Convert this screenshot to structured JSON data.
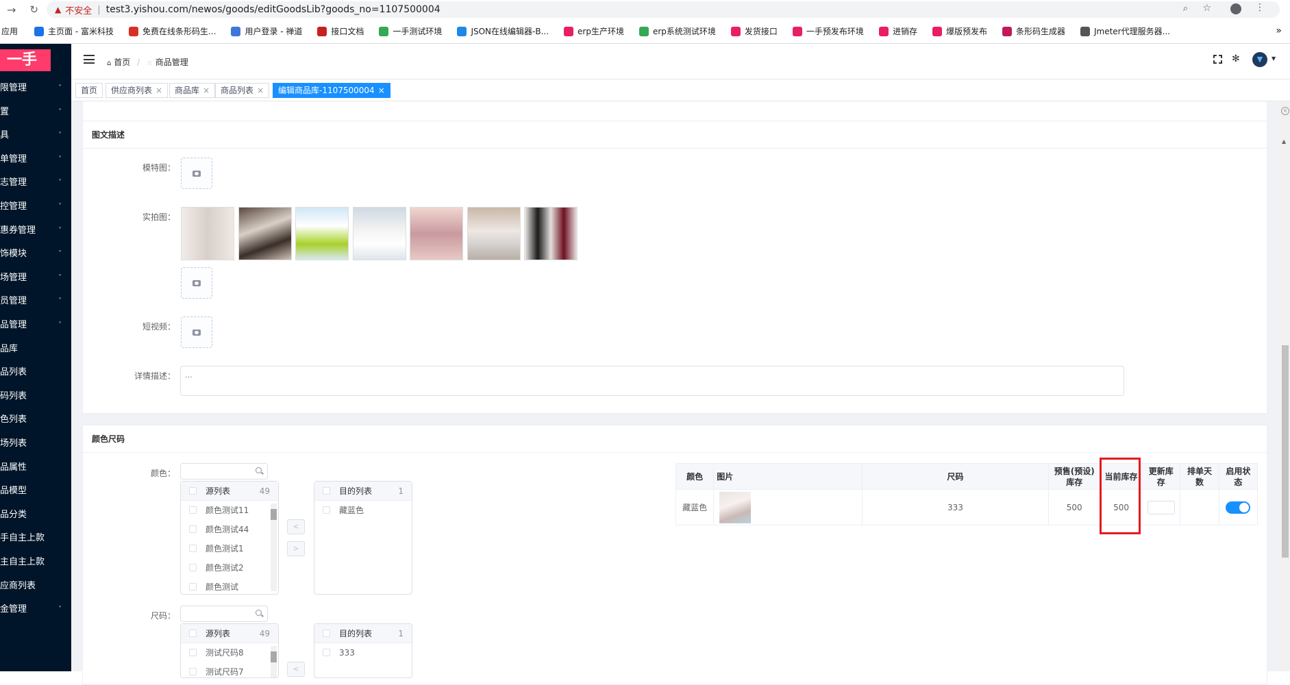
{
  "browser": {
    "insecure_label": "不安全",
    "url": "test3.yishou.com/newos/goods/editGoodsLib?goods_no=1107500004",
    "bookmarks": [
      {
        "label": "应用",
        "color": "#4285f4"
      },
      {
        "label": "主页面 - 富米科技",
        "color": "#1a73e8"
      },
      {
        "label": "免费在线条形码生...",
        "color": "#d93025"
      },
      {
        "label": "用户登录 - 禅道",
        "color": "#3c78d8"
      },
      {
        "label": "接口文档",
        "color": "#c5221f"
      },
      {
        "label": "一手测试环境",
        "color": "#34a853"
      },
      {
        "label": "JSON在线编辑器-B...",
        "color": "#1e88e5"
      },
      {
        "label": "erp生产环境",
        "color": "#e91e63"
      },
      {
        "label": "erp系统测试环境",
        "color": "#34a853"
      },
      {
        "label": "发货接口",
        "color": "#e91e63"
      },
      {
        "label": "一手预发布环境",
        "color": "#e91e63"
      },
      {
        "label": "进销存",
        "color": "#e91e63"
      },
      {
        "label": "爆版预发布",
        "color": "#e91e63"
      },
      {
        "label": "条形码生成器",
        "color": "#c2185b"
      },
      {
        "label": "Jmeter代理服务器...",
        "color": "#555555"
      }
    ],
    "more": "»"
  },
  "sidebar": {
    "logo": "一手",
    "items": [
      {
        "label": "限管理",
        "chevron": "˅"
      },
      {
        "label": "置",
        "chevron": "˅"
      },
      {
        "label": "具",
        "chevron": "˅"
      },
      {
        "label": "单管理",
        "chevron": "˅"
      },
      {
        "label": "志管理",
        "chevron": "˅"
      },
      {
        "label": "控管理",
        "chevron": "˅"
      },
      {
        "label": "惠券管理",
        "chevron": "˅"
      },
      {
        "label": "饰模块",
        "chevron": "˅"
      },
      {
        "label": "场管理",
        "chevron": "˅"
      },
      {
        "label": "员管理",
        "chevron": "˅"
      },
      {
        "label": "品管理",
        "chevron": "˄"
      },
      {
        "label": "品库",
        "chevron": ""
      },
      {
        "label": "品列表",
        "chevron": ""
      },
      {
        "label": "码列表",
        "chevron": ""
      },
      {
        "label": "色列表",
        "chevron": ""
      },
      {
        "label": "场列表",
        "chevron": ""
      },
      {
        "label": "品属性",
        "chevron": ""
      },
      {
        "label": "品模型",
        "chevron": ""
      },
      {
        "label": "品分类",
        "chevron": ""
      },
      {
        "label": "手自主上款",
        "chevron": ""
      },
      {
        "label": "主自主上款",
        "chevron": ""
      },
      {
        "label": "应商列表",
        "chevron": ""
      },
      {
        "label": "金管理",
        "chevron": "˅"
      }
    ]
  },
  "header": {
    "home": "首页",
    "sep": "/",
    "current": "商品管理"
  },
  "tabs": [
    {
      "label": "首页",
      "close": ""
    },
    {
      "label": "供应商列表",
      "close": "×"
    },
    {
      "label": "商品库",
      "close": "×"
    },
    {
      "label": "商品列表",
      "close": "×"
    },
    {
      "label": "编辑商品库-1107500004",
      "close": "×"
    }
  ],
  "desc_section": {
    "title": "图文描述",
    "model_label": "模特图：",
    "real_label": "实拍图：",
    "video_label": "短视频：",
    "detail_label": "详情描述：",
    "detail_placeholder": "..."
  },
  "color_size": {
    "title": "颜色尺码",
    "color_label": "颜色：",
    "size_label": "尺码：",
    "source_title": "源列表",
    "target_title": "目的列表",
    "color_source_count": "49",
    "color_target_count": "1",
    "color_source_items": [
      "颜色测试11",
      "颜色测试44",
      "颜色测试1",
      "颜色测试2",
      "颜色测试"
    ],
    "color_target_items": [
      "藏蓝色"
    ],
    "size_source_count": "49",
    "size_target_count": "1",
    "size_source_items": [
      "测试尺码8",
      "测试尺码7"
    ],
    "size_target_items": [
      "333"
    ],
    "arrow_left": "<",
    "arrow_right": ">"
  },
  "sku_table": {
    "headers": [
      "颜色",
      "图片",
      "尺码",
      "预售(预设)库存",
      "当前库存",
      "更新库存",
      "排单天数",
      "启用状态"
    ],
    "rows": [
      {
        "color": "藏蓝色",
        "size": "333",
        "presale_stock": "500",
        "current_stock": "500",
        "update_stock": "",
        "schedule_days": "",
        "enabled": true
      }
    ]
  }
}
